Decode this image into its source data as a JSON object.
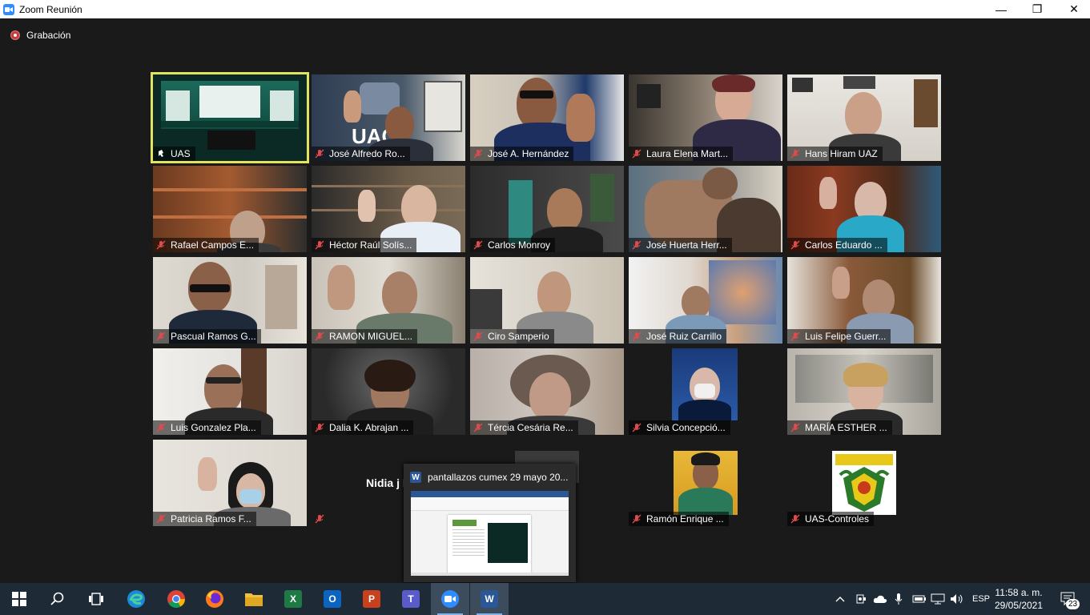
{
  "window": {
    "title": "Zoom Reunión",
    "minimize_glyph": "—",
    "maximize_glyph": "❐",
    "close_glyph": "✕"
  },
  "recording": {
    "label": "Grabación"
  },
  "participants": [
    {
      "name": "UAS"
    },
    {
      "name": "José Alfredo Ro..."
    },
    {
      "name": "José A. Hernández"
    },
    {
      "name": "Laura Elena Mart..."
    },
    {
      "name": "Hans Hiram UAZ"
    },
    {
      "name": "Rafael Campos E..."
    },
    {
      "name": "Héctor Raúl Solís..."
    },
    {
      "name": "Carlos Monroy"
    },
    {
      "name": "José Huerta Herr..."
    },
    {
      "name": "Carlos Eduardo ..."
    },
    {
      "name": "Pascual Ramos G..."
    },
    {
      "name": "RAMON MIGUEL..."
    },
    {
      "name": "Ciro Samperio"
    },
    {
      "name": "José Ruiz Carrillo"
    },
    {
      "name": "Luis Felipe Guerr..."
    },
    {
      "name": "Luis Gonzalez Pla..."
    },
    {
      "name": "Dalia K. Abrajan ..."
    },
    {
      "name": "Tércia Cesária Re..."
    },
    {
      "name": "Silvia Concepció..."
    },
    {
      "name": "MARÍA ESTHER ..."
    },
    {
      "name": "Patricia Ramos F..."
    },
    {
      "name": "Nidia j R"
    },
    {
      "name": ""
    },
    {
      "name": "Ramón Enrique ..."
    },
    {
      "name": "UAS-Controles"
    }
  ],
  "taskbar_preview": {
    "icon_letter": "W",
    "title": "pantallazos cumex 29 mayo 20..."
  },
  "taskbar": {
    "apps": [
      {
        "icon": "windows-start-icon"
      },
      {
        "icon": "search-icon"
      },
      {
        "icon": "task-view-icon"
      },
      {
        "icon": "edge-icon"
      },
      {
        "icon": "chrome-icon"
      },
      {
        "icon": "firefox-icon"
      },
      {
        "icon": "file-explorer-icon"
      },
      {
        "icon": "excel-icon",
        "letter": "X"
      },
      {
        "icon": "outlook-icon",
        "letter": "O"
      },
      {
        "icon": "powerpoint-icon",
        "letter": "P"
      },
      {
        "icon": "teams-icon",
        "letter": "T"
      },
      {
        "icon": "zoom-icon"
      },
      {
        "icon": "word-icon",
        "letter": "W"
      }
    ],
    "language": "ESP",
    "time": "11:58 a. m.",
    "date": "29/05/2021",
    "notifications_count": "23"
  },
  "colors": {
    "active_speaker_border": "#e3e35f",
    "stage_bg": "#1a1a1a",
    "taskbar_bg": "#1e2a36",
    "zoom_blue": "#2d8cff"
  }
}
